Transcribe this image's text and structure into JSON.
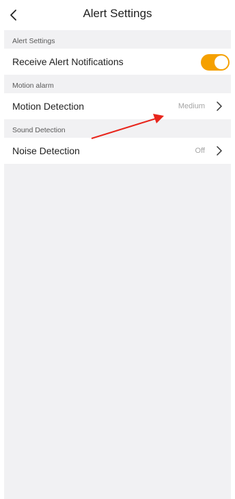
{
  "header": {
    "title": "Alert Settings",
    "back_icon": "chevron-left-icon"
  },
  "sections": [
    {
      "label": "Alert Settings",
      "rows": [
        {
          "label": "Receive Alert Notifications",
          "type": "toggle",
          "on": true
        }
      ]
    },
    {
      "label": "Motion alarm",
      "rows": [
        {
          "label": "Motion Detection",
          "value": "Medium",
          "type": "link"
        }
      ]
    },
    {
      "label": "Sound Detection",
      "rows": [
        {
          "label": "Noise Detection",
          "value": "Off",
          "type": "link"
        }
      ]
    }
  ],
  "colors": {
    "accent": "#f5a000",
    "background": "#f1f1f3",
    "annotation_arrow": "#e8251c"
  }
}
